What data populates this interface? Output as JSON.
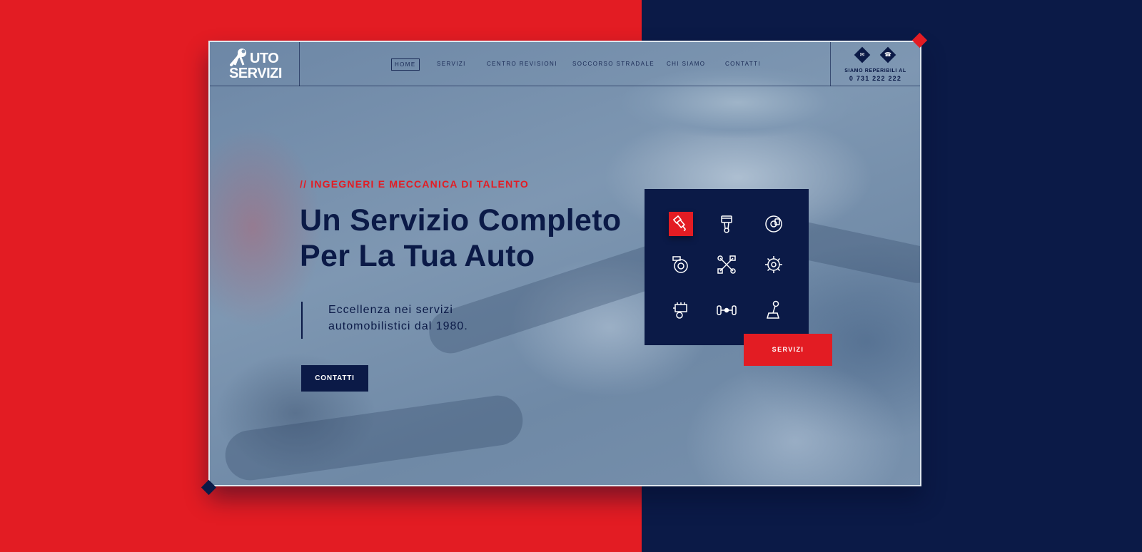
{
  "colors": {
    "accent_red": "#e31c23",
    "navy": "#0b1a47",
    "card_border": "#dfe7ee"
  },
  "logo": {
    "line1": "UTO",
    "line2": "SERVIZI",
    "icon": "wrench-icon"
  },
  "nav": {
    "items": [
      {
        "label": "HOME",
        "active": true
      },
      {
        "label": "SERVIZI"
      },
      {
        "label": "CENTRO REVISIONI"
      },
      {
        "label": "SOCCORSO STRADALE"
      },
      {
        "label": "CHI SIAMO"
      },
      {
        "label": "CONTATTI"
      }
    ]
  },
  "contact": {
    "icons": [
      "mail-icon",
      "phone-icon"
    ],
    "label": "SIAMO REPERIBILI AL",
    "phone": "0 731 222 222"
  },
  "hero": {
    "eyebrow": "// INGEGNERI E MECCANICA DI TALENTO",
    "title_line1": "Un Servizio Completo",
    "title_line2": "Per La Tua Auto",
    "quote_line1": "Eccellenza nei servizi",
    "quote_line2": "automobilistici dal 1980.",
    "cta_label": "CONTATTI"
  },
  "services": {
    "icons": [
      "spark-plug-icon",
      "piston-icon",
      "brake-disc-icon",
      "turbo-icon",
      "wrench-piston-icon",
      "gear-icon",
      "engine-icon",
      "axle-icon",
      "gear-shift-icon"
    ],
    "active_index": 0,
    "button_label": "SERVIZI"
  }
}
